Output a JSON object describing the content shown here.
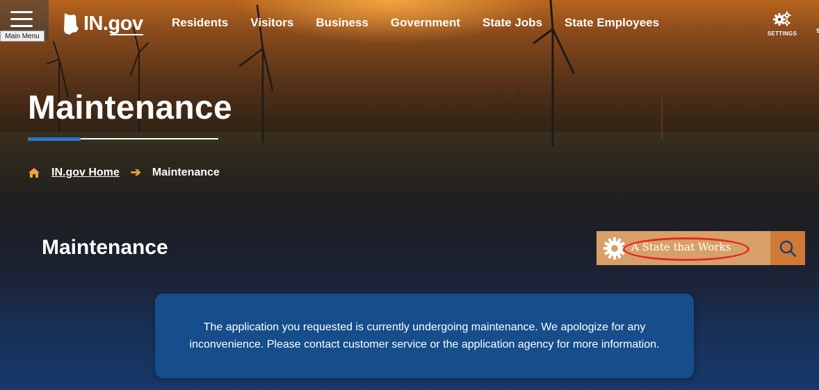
{
  "header": {
    "menu_tooltip": "Main Menu",
    "logo_text": "IN.gov",
    "nav": [
      "Residents",
      "Visitors",
      "Business",
      "Government",
      "State Jobs",
      "State Employees"
    ],
    "settings_label": "SETTINGS",
    "edge_label": "S"
  },
  "hero": {
    "title": "Maintenance",
    "breadcrumb": {
      "home_label": "IN.gov Home",
      "current": "Maintenance"
    }
  },
  "main": {
    "section_title": "Maintenance",
    "banner": {
      "text": "A State that Works",
      "search_icon": "search-icon"
    },
    "alert_message": "The application you requested is currently undergoing maintenance. We apologize for any inconvenience. Please contact customer service or the application agency for more information."
  },
  "colors": {
    "accent_blue": "#2a77c9",
    "breadcrumb_arrow": "#f1a43a",
    "banner_tan": "#d8a069",
    "banner_orange": "#d07a37",
    "alert_blue": "#164d8b",
    "highlight_red": "#e42a20"
  }
}
